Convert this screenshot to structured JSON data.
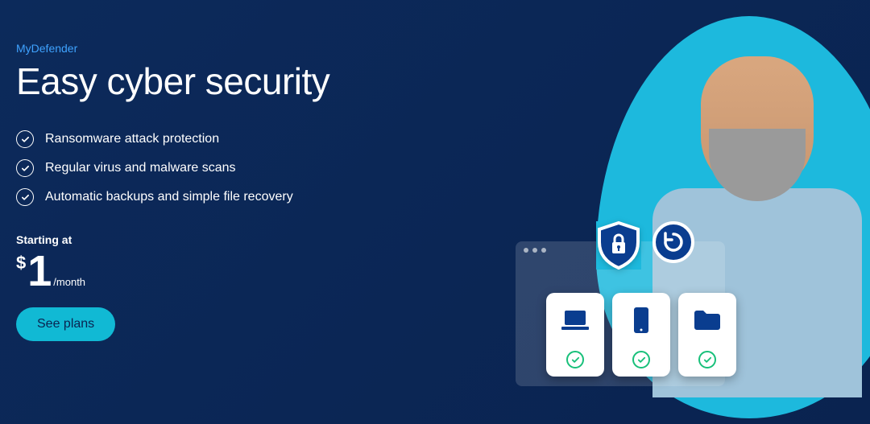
{
  "eyebrow": "MyDefender",
  "headline": "Easy cyber security",
  "features": [
    "Ransomware attack protection",
    "Regular virus and malware scans",
    "Automatic backups and simple file recovery"
  ],
  "pricing": {
    "label": "Starting at",
    "currency": "$",
    "amount": "1",
    "period": "/month"
  },
  "cta": "See plans"
}
